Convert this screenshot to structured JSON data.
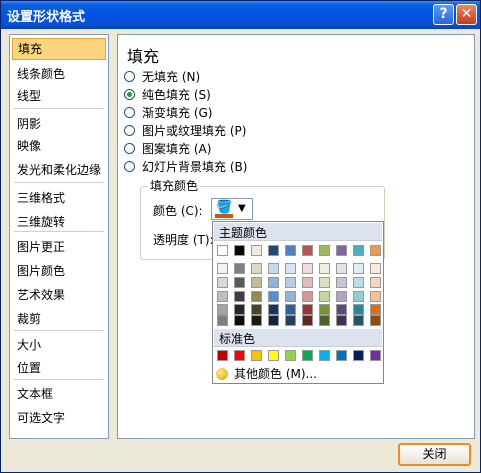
{
  "window": {
    "title": "设置形状格式",
    "help_icon": "question-icon",
    "close_icon": "close-icon"
  },
  "sidebar": {
    "items": [
      {
        "label": "填充"
      },
      {
        "label": "线条颜色"
      },
      {
        "label": "线型"
      },
      {
        "label": "阴影"
      },
      {
        "label": "映像"
      },
      {
        "label": "发光和柔化边缘"
      },
      {
        "label": "三维格式"
      },
      {
        "label": "三维旋转"
      },
      {
        "label": "图片更正"
      },
      {
        "label": "图片颜色"
      },
      {
        "label": "艺术效果"
      },
      {
        "label": "裁剪"
      },
      {
        "label": "大小"
      },
      {
        "label": "位置"
      },
      {
        "label": "文本框"
      },
      {
        "label": "可选文字"
      }
    ],
    "selected": "填充"
  },
  "fill": {
    "heading": "填充",
    "options": [
      {
        "label": "无填充 (N)",
        "checked": false
      },
      {
        "label": "纯色填充 (S)",
        "checked": true
      },
      {
        "label": "渐变填充 (G)",
        "checked": false
      },
      {
        "label": "图片或纹理填充 (P)",
        "checked": false
      },
      {
        "label": "图案填充 (A)",
        "checked": false
      },
      {
        "label": "幻灯片背景填充 (B)",
        "checked": false
      }
    ],
    "group_title": "填充颜色",
    "color_label": "颜色 (C):",
    "transparency_label": "透明度 (T):"
  },
  "palette": {
    "theme_title": "主题颜色",
    "standard_title": "标准色",
    "more_colors": "其他颜色 (M)...",
    "selected_color": "#c55a11",
    "theme_top": [
      "#ffffff",
      "#000000",
      "#eeece1",
      "#1f497d",
      "#4f81bd",
      "#c0504d",
      "#9bbb59",
      "#8064a2",
      "#4bacc6",
      "#f79646"
    ],
    "theme_shades": [
      [
        "#f2f2f2",
        "#7f7f7f",
        "#ddd9c3",
        "#c6d9f0",
        "#dbe5f1",
        "#f2dcdb",
        "#ebf1dd",
        "#e5e0ec",
        "#dbeef3",
        "#fdeada"
      ],
      [
        "#d8d8d8",
        "#595959",
        "#c4bd97",
        "#8db3e2",
        "#b8cce4",
        "#e5b9b7",
        "#d7e3bc",
        "#ccc1d9",
        "#b7dde8",
        "#fbd5b5"
      ],
      [
        "#bfbfbf",
        "#3f3f3f",
        "#938953",
        "#548dd4",
        "#95b3d7",
        "#d99694",
        "#c3d69b",
        "#b2a2c7",
        "#92cddc",
        "#fac08f"
      ],
      [
        "#a5a5a5",
        "#262626",
        "#494429",
        "#17365d",
        "#366092",
        "#953734",
        "#76923c",
        "#5f497a",
        "#31859b",
        "#e36c09"
      ],
      [
        "#7f7f7f",
        "#0c0c0c",
        "#1d1b10",
        "#0f243e",
        "#244061",
        "#632423",
        "#4f6128",
        "#3f3151",
        "#205867",
        "#974806"
      ]
    ],
    "standard": [
      "#c00000",
      "#ff0000",
      "#ffc000",
      "#ffff00",
      "#92d050",
      "#00b050",
      "#00b0f0",
      "#0070c0",
      "#002060",
      "#7030a0"
    ]
  },
  "footer": {
    "close_label": "关闭"
  }
}
